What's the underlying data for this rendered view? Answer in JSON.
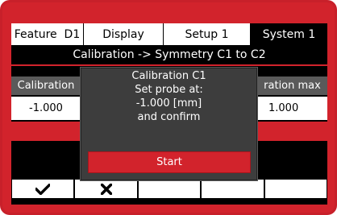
{
  "tabs": [
    {
      "label": "Feature  D1",
      "active": false
    },
    {
      "label": "Display",
      "active": false
    },
    {
      "label": "Setup 1",
      "active": false
    },
    {
      "label": "System 1",
      "active": true
    }
  ],
  "page_title": "Calibration -> Symmetry C1 to C2",
  "table": {
    "left_header": "Calibration",
    "right_header": "ration max",
    "left_value": "-1.000",
    "right_value": "1.000"
  },
  "dialog": {
    "title": "Calibration C1",
    "line1": "Set probe at:",
    "line2": "-1.000 [mm]",
    "line3": "and confirm",
    "button": "Start"
  },
  "function_keys": [
    {
      "icon": "checkmark-icon"
    },
    {
      "icon": "x-icon"
    },
    {
      "icon": ""
    },
    {
      "icon": ""
    },
    {
      "icon": ""
    }
  ],
  "colors": {
    "accent": "#d2232c",
    "background": "#000000",
    "dialog": "#3d3d3d"
  }
}
